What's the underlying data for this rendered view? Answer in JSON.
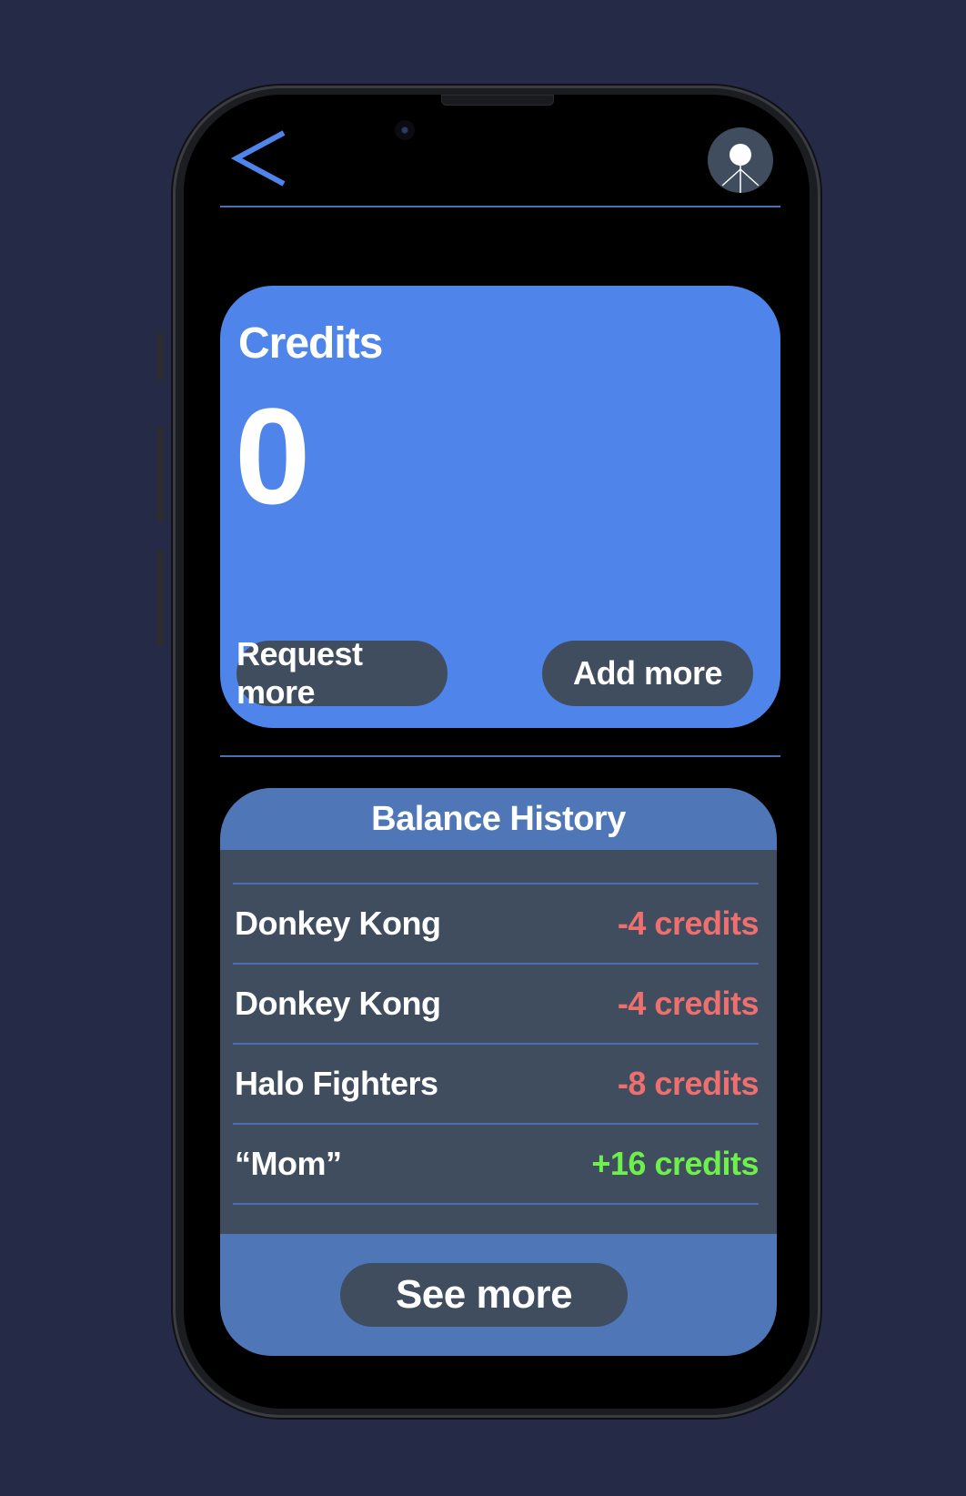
{
  "header": {
    "back_icon": "chevron-left-icon",
    "avatar_icon": "user-avatar-icon"
  },
  "credits": {
    "title": "Credits",
    "value": "0",
    "request_label": "Request more",
    "add_label": "Add more"
  },
  "history": {
    "title": "Balance History",
    "items": [
      {
        "name": "Donkey Kong",
        "amount": "-4 credits",
        "type": "negative"
      },
      {
        "name": "Donkey Kong",
        "amount": "-4 credits",
        "type": "negative"
      },
      {
        "name": "Halo Fighters",
        "amount": "-8 credits",
        "type": "negative"
      },
      {
        "name": "“Mom”",
        "amount": "+16 credits",
        "type": "positive"
      }
    ],
    "see_more_label": "See more"
  },
  "colors": {
    "background": "#252a47",
    "card_blue": "#4f85eb",
    "history_blue": "#4f77b8",
    "pill_gray": "#3f4d5f",
    "negative": "#ef6f6f",
    "positive": "#6ef04a"
  }
}
